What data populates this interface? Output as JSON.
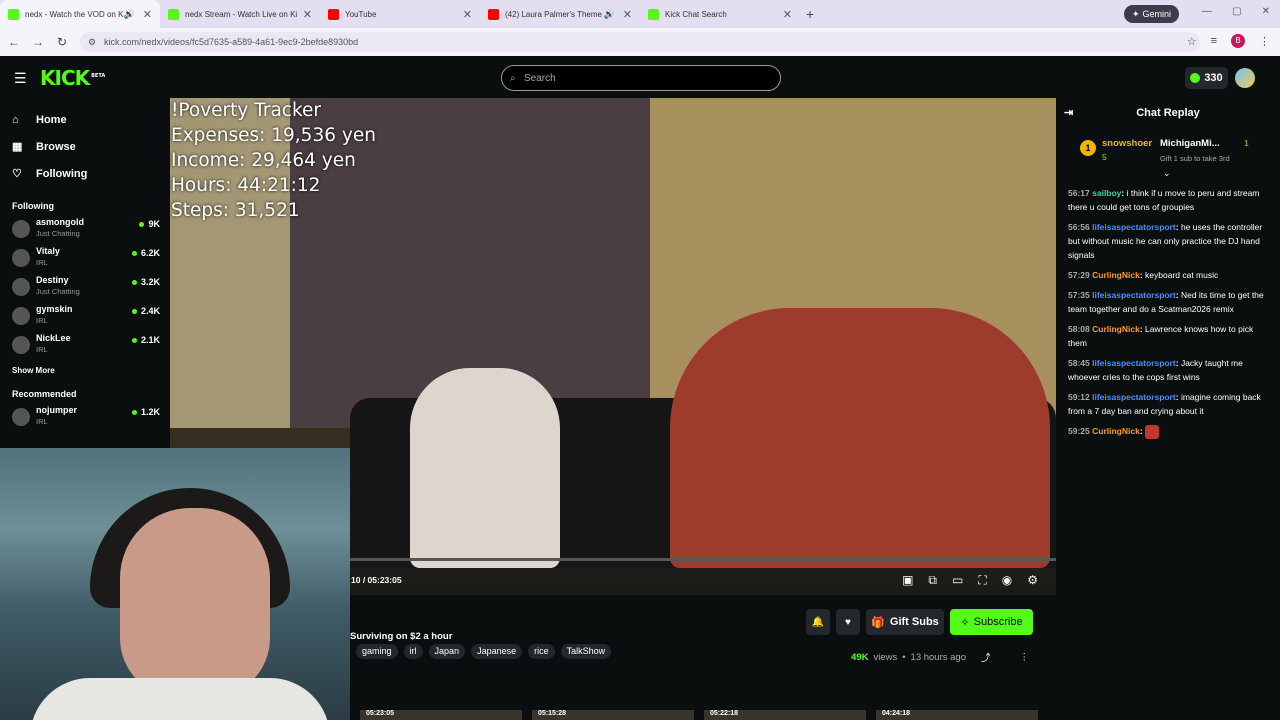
{
  "browser": {
    "tabs": [
      {
        "title": "nedx - Watch the VOD on Ki",
        "favicon_color": "#53fc18",
        "sound": "🔊",
        "active": true
      },
      {
        "title": "nedx Stream - Watch Live on Ki",
        "favicon_color": "#53fc18",
        "sound": "",
        "active": false
      },
      {
        "title": "YouTube",
        "favicon_color": "#ff0000",
        "sound": "",
        "active": false
      },
      {
        "title": "(42) Laura Palmer's Theme",
        "favicon_color": "#ff0000",
        "sound": "🔊",
        "active": false
      },
      {
        "title": "Kick Chat Search",
        "favicon_color": "#53fc18",
        "sound": "",
        "active": false
      }
    ],
    "gemini_label": "Gemini",
    "url": "kick.com/nedx/videos/fc5d7635-a589-4a61-9ec9-2befde8930bd",
    "profile_initial": "B"
  },
  "kick": {
    "logo": "KICK",
    "logo_badge": "BETA",
    "search_placeholder": "Search",
    "kicks_balance": "330",
    "accent": "#53fc18"
  },
  "sidebar": {
    "nav": [
      {
        "label": "Home",
        "icon": "⌂"
      },
      {
        "label": "Browse",
        "icon": "▦"
      },
      {
        "label": "Following",
        "icon": "♡"
      }
    ],
    "following_header": "Following",
    "following": [
      {
        "name": "asmongold",
        "category": "Just Chatting",
        "viewers": "9K"
      },
      {
        "name": "Vitaly",
        "category": "IRL",
        "viewers": "6.2K"
      },
      {
        "name": "Destiny",
        "category": "Just Chatting",
        "viewers": "3.2K"
      },
      {
        "name": "gymskin",
        "category": "IRL",
        "viewers": "2.4K"
      },
      {
        "name": "NickLee",
        "category": "IRL",
        "viewers": "2.1K"
      }
    ],
    "show_more": "Show More",
    "recommended_header": "Recommended",
    "recommended": [
      {
        "name": "nojumper",
        "category": "IRL",
        "viewers": "1.2K"
      }
    ]
  },
  "video": {
    "overlay_lines": [
      "!Poverty Tracker",
      "Expenses: 19,536 yen",
      "Income: 29,464 yen",
      "Hours: 44:21:12",
      "Steps: 31,521"
    ],
    "time": "10 / 05:23:05",
    "progress": 0.0
  },
  "below": {
    "gift_label": "Gift Subs",
    "subscribe_label": "Subscribe",
    "title": "Surviving on $2 a hour",
    "tags": [
      "gaming",
      "irl",
      "Japan",
      "Japanese",
      "rice",
      "TalkShow"
    ],
    "views": "49K",
    "views_label": "views",
    "age": "13 hours ago",
    "thumb_times": [
      "05:23:05",
      "05:15:28",
      "05:22:18",
      "04:24:18"
    ]
  },
  "chat": {
    "title": "Chat Replay",
    "pinned": {
      "rank": "1",
      "user1": "snowshoer",
      "count1": "5",
      "user2": "MichiganMi...",
      "count2": "1",
      "gift_text": "Gift 1 sub to take 3rd"
    },
    "messages": [
      {
        "time": "56:17",
        "user": "sailboy",
        "color": "#3fd1a6",
        "text": "i think if u move to peru and stream there u could get tons of groupies"
      },
      {
        "time": "56:56",
        "user": "lifeisaspectatorsport",
        "color": "#4f8cff",
        "text": "he uses the controller but without music he can only practice the DJ hand signals"
      },
      {
        "time": "57:29",
        "user": "CurlingNick",
        "color": "#ff9a1f",
        "text": "keyboard cat music"
      },
      {
        "time": "57:35",
        "user": "lifeisaspectatorsport",
        "color": "#4f8cff",
        "text": "Ned its time to get the team together and do a Scatman2026 remix"
      },
      {
        "time": "58:08",
        "user": "CurlingNick",
        "color": "#ff9a1f",
        "text": "Lawrence knows how to pick them"
      },
      {
        "time": "58:45",
        "user": "lifeisaspectatorsport",
        "color": "#4f8cff",
        "text": "Jacky taught me whoever cries to the cops first wins"
      },
      {
        "time": "59:12",
        "user": "lifeisaspectatorsport",
        "color": "#4f8cff",
        "text": "imagine coming back from a 7 day ban and crying about it"
      },
      {
        "time": "59:25",
        "user": "CurlingNick",
        "color": "#ff9a1f",
        "text": ""
      }
    ]
  }
}
